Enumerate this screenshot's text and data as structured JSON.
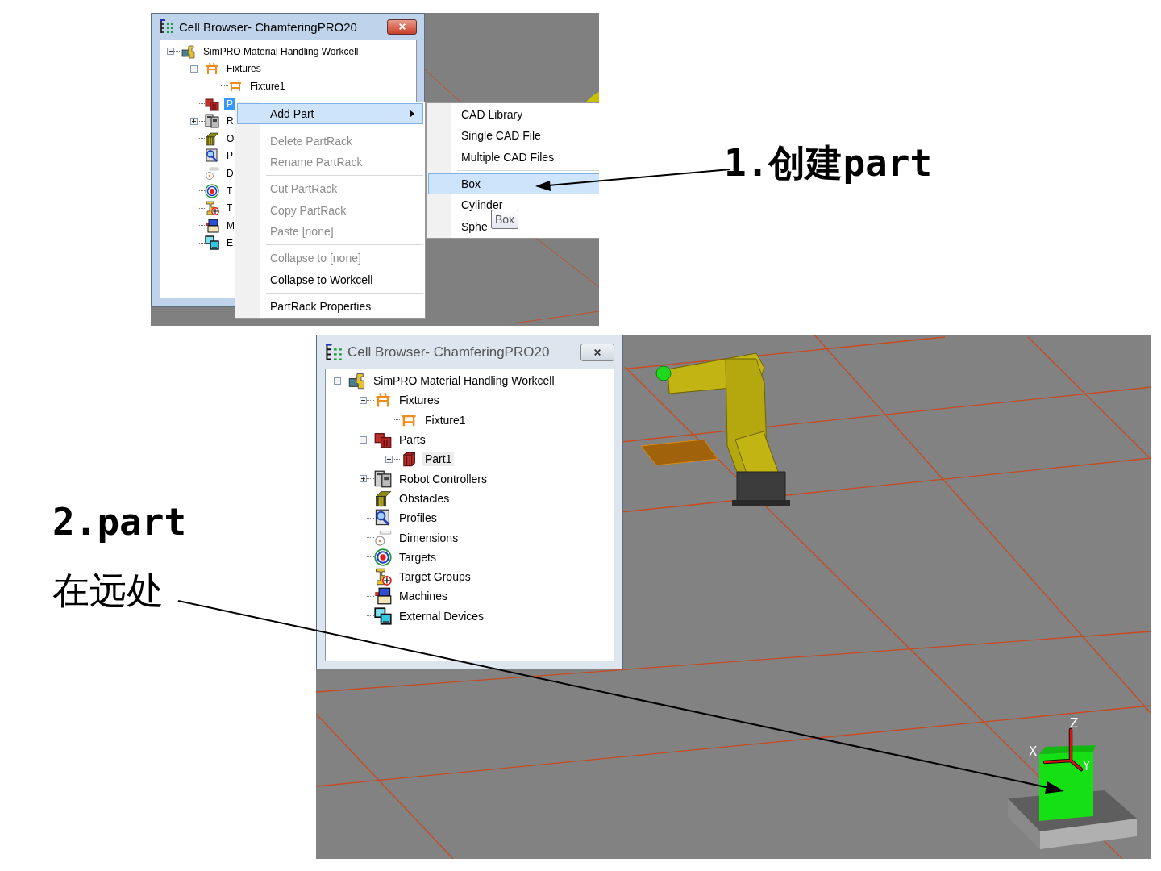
{
  "step1_screenshot": {
    "window": {
      "title": "Cell Browser- ChamferingPRO20",
      "active": true
    },
    "tree": {
      "focused": true,
      "nodes": [
        {
          "kind": "workcell",
          "label": "SimPRO Material Handling Workcell",
          "expanded": true,
          "selected": false,
          "children": [
            {
              "kind": "fixtures",
              "label": "Fixtures",
              "expanded": true,
              "selected": false,
              "children": [
                {
                  "kind": "fixture",
                  "label": "Fixture1",
                  "selected": false
                }
              ]
            },
            {
              "kind": "parts",
              "label": "P",
              "selected": true
            },
            {
              "kind": "controllers",
              "label": "R",
              "expanded": false,
              "selected": false
            },
            {
              "kind": "obstacles",
              "label": "O",
              "selected": false
            },
            {
              "kind": "profiles",
              "label": "P",
              "selected": false
            },
            {
              "kind": "dimensions",
              "label": "D",
              "selected": false
            },
            {
              "kind": "targets",
              "label": "T",
              "selected": false
            },
            {
              "kind": "target_groups",
              "label": "T",
              "selected": false
            },
            {
              "kind": "machines",
              "label": "M",
              "selected": false
            },
            {
              "kind": "devices",
              "label": "E",
              "selected": false
            }
          ]
        }
      ]
    },
    "context_menu": {
      "items": [
        {
          "kind": "item",
          "label": "Add Part",
          "selected": true,
          "disabled": false,
          "submenu": true
        },
        {
          "kind": "separator"
        },
        {
          "kind": "item",
          "label": "Delete PartRack",
          "selected": false,
          "disabled": true,
          "submenu": false
        },
        {
          "kind": "item",
          "label": "Rename PartRack",
          "selected": false,
          "disabled": true,
          "submenu": false
        },
        {
          "kind": "separator"
        },
        {
          "kind": "item",
          "label": "Cut PartRack",
          "selected": false,
          "disabled": true,
          "submenu": false
        },
        {
          "kind": "item",
          "label": "Copy PartRack",
          "selected": false,
          "disabled": true,
          "submenu": false
        },
        {
          "kind": "item",
          "label": "Paste [none]",
          "selected": false,
          "disabled": true,
          "submenu": false
        },
        {
          "kind": "separator"
        },
        {
          "kind": "item",
          "label": "Collapse to [none]",
          "selected": false,
          "disabled": true,
          "submenu": false
        },
        {
          "kind": "item",
          "label": "Collapse to Workcell",
          "selected": false,
          "disabled": false,
          "submenu": false
        },
        {
          "kind": "separator"
        },
        {
          "kind": "item",
          "label": "PartRack Properties",
          "selected": false,
          "disabled": false,
          "submenu": false
        }
      ]
    },
    "submenu": {
      "items": [
        {
          "kind": "item",
          "label": "CAD Library",
          "selected": false
        },
        {
          "kind": "item",
          "label": "Single CAD File",
          "selected": false
        },
        {
          "kind": "item",
          "label": "Multiple CAD Files",
          "selected": false
        },
        {
          "kind": "separator"
        },
        {
          "kind": "item",
          "label": "Box",
          "selected": true
        },
        {
          "kind": "item",
          "label": "Cylinder",
          "selected": false
        },
        {
          "kind": "item",
          "label": "Sphe",
          "selected": false
        }
      ]
    },
    "tooltip": "Box"
  },
  "step2_screenshot": {
    "window": {
      "title": "Cell Browser- ChamferingPRO20",
      "active": false
    },
    "tree": {
      "focused": false,
      "nodes": [
        {
          "kind": "workcell",
          "label": "SimPRO Material Handling Workcell",
          "expanded": true,
          "selected": false,
          "children": [
            {
              "kind": "fixtures",
              "label": "Fixtures",
              "expanded": true,
              "selected": false,
              "children": [
                {
                  "kind": "fixture",
                  "label": "Fixture1",
                  "selected": false
                }
              ]
            },
            {
              "kind": "parts",
              "label": "Parts",
              "expanded": true,
              "selected": false,
              "children": [
                {
                  "kind": "part",
                  "label": "Part1",
                  "expanded": false,
                  "selected": true
                }
              ]
            },
            {
              "kind": "controllers",
              "label": "Robot Controllers",
              "expanded": false,
              "selected": false
            },
            {
              "kind": "obstacles",
              "label": "Obstacles",
              "selected": false
            },
            {
              "kind": "profiles",
              "label": "Profiles",
              "selected": false
            },
            {
              "kind": "dimensions",
              "label": "Dimensions",
              "selected": false
            },
            {
              "kind": "targets",
              "label": "Targets",
              "selected": false
            },
            {
              "kind": "target_groups",
              "label": "Target Groups",
              "selected": false
            },
            {
              "kind": "machines",
              "label": "Machines",
              "selected": false
            },
            {
              "kind": "devices",
              "label": "External Devices",
              "selected": false
            }
          ]
        }
      ]
    },
    "viewport": {
      "axis_labels": [
        "Z",
        "X",
        "Y"
      ]
    }
  },
  "annotations": [
    {
      "text": "1.创建part"
    },
    {
      "text": "2.part"
    },
    {
      "text": "在远处"
    }
  ]
}
